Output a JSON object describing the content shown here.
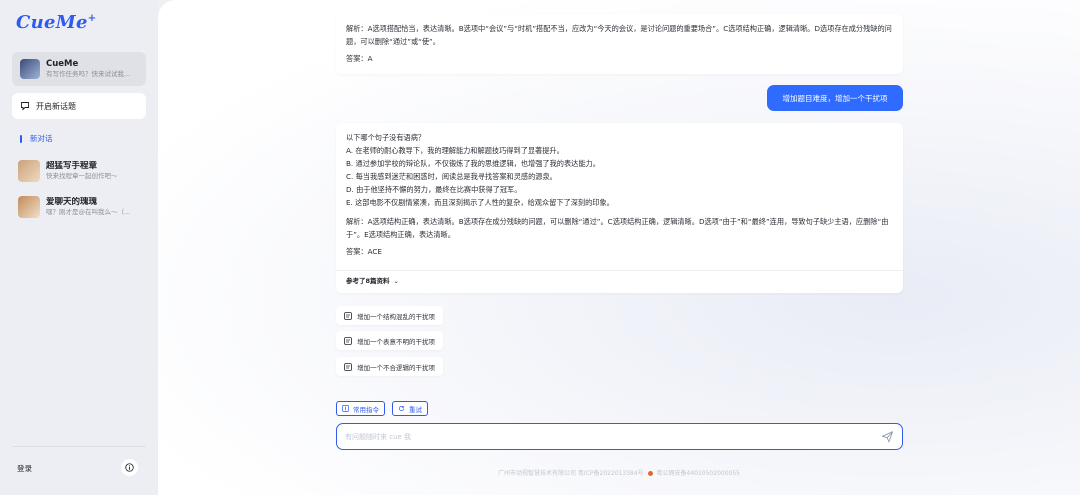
{
  "sidebar": {
    "logo": "CueMe",
    "logo_mark": "+",
    "agent": {
      "name": "CueMe",
      "subtitle": "有写作任务吗？快来试试我..."
    },
    "new_chat": "开启新话题",
    "current_chat": "新对话",
    "chats": [
      {
        "title": "超猛写手程章",
        "subtitle": "快来找程章一起创作吧～"
      },
      {
        "title": "爱聊天的瑰瑰",
        "subtitle": "嘿？刚才是@在叫我么～（..."
      }
    ],
    "logout": "登录"
  },
  "conversation": {
    "card1": [
      "解析：A选项搭配恰当，表达清晰。B选项中“会议”与“时机”搭配不当，应改为“今天的会议，是讨论问题的重要场合”。C选项结构正确，逻辑清晰。D选项存在成分残缺的问题，可以删除“通过”或“使”。",
      "答案：A"
    ],
    "user_message": "增加题目难度，增加一个干扰项",
    "card2": {
      "question": "以下哪个句子没有语病？",
      "options": [
        "A. 在老师的耐心教导下，我的理解能力和解题技巧得到了显著提升。",
        "B. 通过参加学校的辩论队，不仅锻炼了我的思维逻辑，也增强了我的表达能力。",
        "C. 每当我感到迷茫和困惑时，阅读总是我寻找答案和灵感的源泉。",
        "D. 由于他坚持不懈的努力，最终在比赛中获得了冠军。",
        "E. 这部电影不仅剧情紧凑，而且深刻揭示了人性的复杂，给观众留下了深刻的印象。"
      ],
      "analysis": "解析：A选项结构正确，表达清晰。B选项存在成分残缺的问题，可以删除“通过”。C选项结构正确，逻辑清晰。D选项“由于”和“最终”连用，导致句子缺少主语，应删除“由于”。E选项结构正确，表达清晰。",
      "answer": "答案：ACE",
      "refs": "参考了8篇资料"
    },
    "suggestions": [
      "增加一个结构混乱的干扰项",
      "增加一个表意不明的干扰项",
      "增加一个不合逻辑的干扰项"
    ]
  },
  "toolbar": {
    "common_cmd": "常用指令",
    "retry": "重试"
  },
  "input": {
    "placeholder": "有问题随时来 cue 我"
  },
  "footer": {
    "company_icp": "广州市动视智慧技术有限公司 粤ICP备2022013384号",
    "police": "粤公网安备44010502000055"
  },
  "colors": {
    "accent": "#2f5bf0",
    "bubble": "#2f6bff"
  }
}
